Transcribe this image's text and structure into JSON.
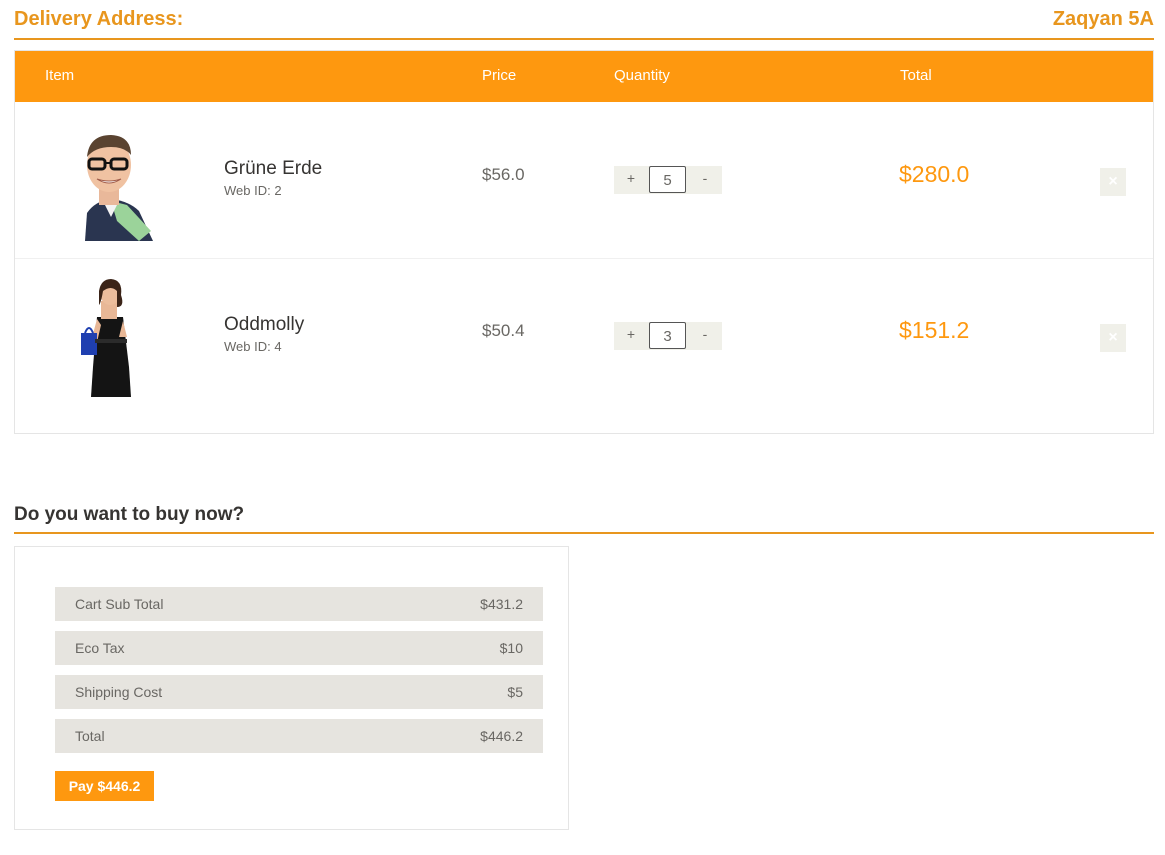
{
  "delivery": {
    "label": "Delivery Address:",
    "value": "Zaqyan 5A"
  },
  "cart": {
    "columns": {
      "item": "Item",
      "price": "Price",
      "quantity": "Quantity",
      "total": "Total"
    },
    "items": [
      {
        "name": "Grüne Erde",
        "web_id": "Web ID: 2",
        "price": "$56.0",
        "qty_plus": "+",
        "quantity": "5",
        "qty_minus": "-",
        "total": "$280.0",
        "delete_icon": "×"
      },
      {
        "name": "Oddmolly",
        "web_id": "Web ID: 4",
        "price": "$50.4",
        "qty_plus": "+",
        "quantity": "3",
        "qty_minus": "-",
        "total": "$151.2",
        "delete_icon": "×"
      }
    ]
  },
  "buy": {
    "title": "Do you want to buy now?",
    "summary": [
      {
        "label": "Cart Sub Total",
        "amount": "$431.2"
      },
      {
        "label": "Eco Tax",
        "amount": "$10"
      },
      {
        "label": "Shipping Cost",
        "amount": "$5"
      },
      {
        "label": "Total",
        "amount": "$446.2"
      }
    ],
    "pay_label": "Pay $446.2"
  },
  "colors": {
    "accent": "#fe980f",
    "heading": "#e8961e",
    "summary_bg": "#e6e4df"
  }
}
